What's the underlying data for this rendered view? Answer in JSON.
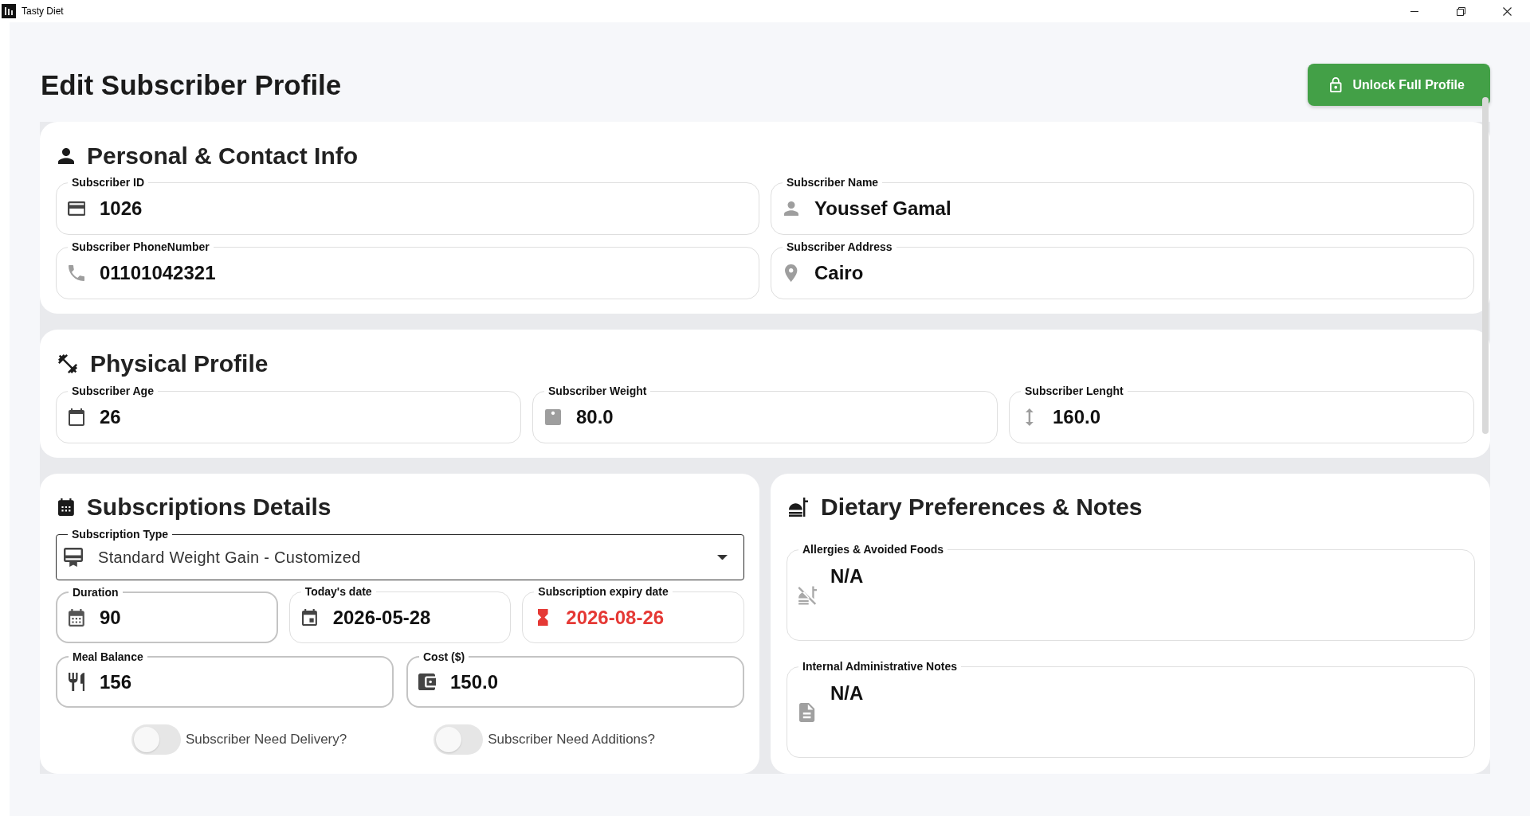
{
  "window": {
    "title": "Tasty Diet"
  },
  "header": {
    "title": "Edit Subscriber Profile",
    "unlock_button": "Unlock Full Profile"
  },
  "personal_contact": {
    "title": "Personal & Contact Info",
    "fields": [
      {
        "label": "Subscriber ID",
        "value": "1026",
        "editable": false
      },
      {
        "label": "Subscriber Name",
        "value": "Youssef Gamal",
        "editable": false
      },
      {
        "label": "Subscriber PhoneNumber",
        "value": "01101042321",
        "editable": false
      },
      {
        "label": "Subscriber Address",
        "value": "Cairo",
        "editable": false
      }
    ]
  },
  "physical_profile": {
    "title": "Physical Profile",
    "fields": [
      {
        "label": "Subscriber Age",
        "value": "26",
        "editable": false
      },
      {
        "label": "Subscriber Weight",
        "value": "80.0",
        "editable": false
      },
      {
        "label": "Subscriber Lenght",
        "value": "160.0",
        "editable": false
      }
    ]
  },
  "subscription_details": {
    "title": "Subscriptions Details",
    "subscription_type": {
      "label": "Subscription Type",
      "value": "Standard Weight Gain - Customized"
    },
    "date_fields": [
      {
        "label": "Duration",
        "value": "90",
        "editable": true
      },
      {
        "label": "Today's date",
        "value": "2026-05-28",
        "editable": false
      },
      {
        "label": "Subscription expiry date",
        "value": "2026-08-26",
        "editable": false,
        "color": "#e53935"
      }
    ],
    "amount_fields": [
      {
        "label": "Meal Balance",
        "value": "156",
        "editable": true
      },
      {
        "label": "Cost ($)",
        "value": "150.0",
        "editable": true
      }
    ],
    "toggles": [
      {
        "label": "Subscriber Need Delivery?",
        "on": false
      },
      {
        "label": "Subscriber Need Additions?",
        "on": false
      }
    ]
  },
  "dietary_notes": {
    "title": "Dietary Preferences & Notes",
    "fields": [
      {
        "label": "Allergies & Avoided Foods",
        "value": "N/A"
      },
      {
        "label": "Internal Administrative Notes",
        "value": "N/A"
      }
    ]
  }
}
